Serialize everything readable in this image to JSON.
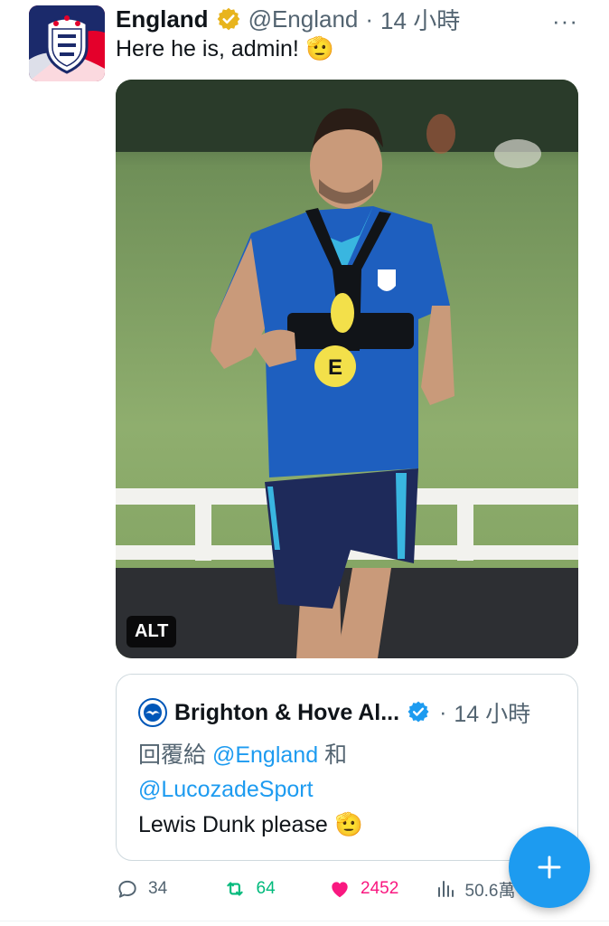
{
  "tweet": {
    "display_name": "England",
    "handle": "@England",
    "separator": "·",
    "time": "14 小時",
    "more_label": "···",
    "text": "Here he is, admin!",
    "emoji": "🫡",
    "photo": {
      "alt_label": "ALT",
      "shirt_sponsor": "E"
    }
  },
  "quote": {
    "display_name": "Brighton & Hove Al...",
    "separator": "·",
    "time": "14 小時",
    "reply_prefix": "回覆給",
    "mention_1": "@England",
    "conjunction": "和",
    "mention_2": "@LucozadeSport",
    "text": "Lewis Dunk please",
    "emoji": "🫡"
  },
  "actions": {
    "reply_count": "34",
    "retweet_count": "64",
    "like_count": "2452",
    "views_count": "50.6萬"
  },
  "colors": {
    "accent": "#1d9bf0",
    "retweet": "#00ba7c",
    "like": "#f91880",
    "verified": "#e8b41d",
    "quote_verified": "#1d9bf0"
  },
  "icons": {
    "reply": "reply-icon",
    "retweet": "retweet-icon",
    "like": "heart-icon",
    "views": "views-icon",
    "fab": "plus-icon"
  }
}
